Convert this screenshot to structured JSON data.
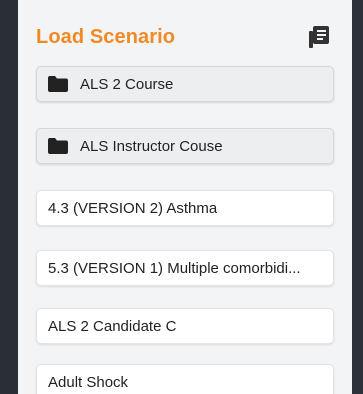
{
  "panel": {
    "title": "Load Scenario",
    "header_icon": "list-icon"
  },
  "colors": {
    "accent": "#f08a26",
    "panel_bg": "#f3f4f5",
    "backdrop": "#2c313a"
  },
  "folders": [
    {
      "label": "ALS 2 Course",
      "icon": "folder-icon"
    },
    {
      "label": "ALS Instructor Couse",
      "icon": "folder-icon"
    }
  ],
  "scenarios": [
    {
      "label": "4.3 (VERSION 2) Asthma"
    },
    {
      "label": "5.3 (VERSION 1) Multiple comorbidi..."
    },
    {
      "label": "ALS 2 Candidate C"
    },
    {
      "label": "Adult Shock"
    }
  ]
}
